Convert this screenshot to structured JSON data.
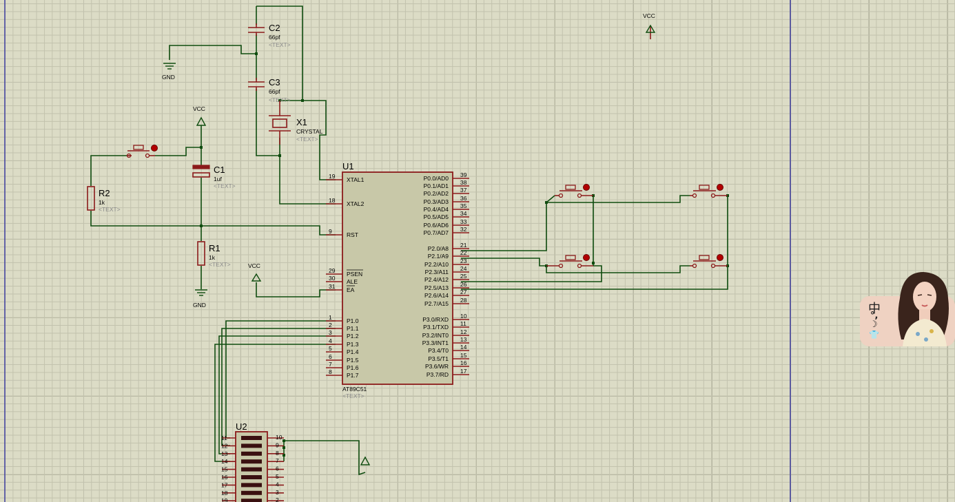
{
  "u1": {
    "ref": "U1",
    "part": "AT89C51",
    "text": "<TEXT>",
    "left_pins": [
      {
        "num": "19",
        "name": "XTAL1"
      },
      {
        "num": "18",
        "name": "XTAL2"
      },
      {
        "num": "9",
        "name": "RST"
      },
      {
        "num": "29",
        "name": "PSEN"
      },
      {
        "num": "30",
        "name": "ALE"
      },
      {
        "num": "31",
        "name": "EA"
      },
      {
        "num": "1",
        "name": "P1.0"
      },
      {
        "num": "2",
        "name": "P1.1"
      },
      {
        "num": "3",
        "name": "P1.2"
      },
      {
        "num": "4",
        "name": "P1.3"
      },
      {
        "num": "5",
        "name": "P1.4"
      },
      {
        "num": "6",
        "name": "P1.5"
      },
      {
        "num": "7",
        "name": "P1.6"
      },
      {
        "num": "8",
        "name": "P1.7"
      }
    ],
    "right_pins": [
      {
        "num": "39",
        "name": "P0.0/AD0"
      },
      {
        "num": "38",
        "name": "P0.1/AD1"
      },
      {
        "num": "37",
        "name": "P0.2/AD2"
      },
      {
        "num": "36",
        "name": "P0.3/AD3"
      },
      {
        "num": "35",
        "name": "P0.4/AD4"
      },
      {
        "num": "34",
        "name": "P0.5/AD5"
      },
      {
        "num": "33",
        "name": "P0.6/AD6"
      },
      {
        "num": "32",
        "name": "P0.7/AD7"
      },
      {
        "num": "21",
        "name": "P2.0/A8"
      },
      {
        "num": "22",
        "name": "P2.1/A9"
      },
      {
        "num": "23",
        "name": "P2.2/A10"
      },
      {
        "num": "24",
        "name": "P2.3/A11"
      },
      {
        "num": "25",
        "name": "P2.4/A12"
      },
      {
        "num": "26",
        "name": "P2.5/A13"
      },
      {
        "num": "27",
        "name": "P2.6/A14"
      },
      {
        "num": "28",
        "name": "P2.7/A15"
      },
      {
        "num": "10",
        "name": "P3.0/RXD"
      },
      {
        "num": "11",
        "name": "P3.1/TXD"
      },
      {
        "num": "12",
        "name": "P3.2/INT0"
      },
      {
        "num": "13",
        "name": "P3.3/INT1"
      },
      {
        "num": "14",
        "name": "P3.4/T0"
      },
      {
        "num": "15",
        "name": "P3.5/T1"
      },
      {
        "num": "16",
        "name": "P3.6/WR"
      },
      {
        "num": "17",
        "name": "P3.7/RD"
      }
    ]
  },
  "c2": {
    "ref": "C2",
    "value": "66pf",
    "text": "<TEXT>"
  },
  "c3": {
    "ref": "C3",
    "value": "66pf",
    "text": "<TEXT>"
  },
  "x1": {
    "ref": "X1",
    "value": "CRYSTAL",
    "text": "<TEXT>"
  },
  "c1": {
    "ref": "C1",
    "value": "1uf",
    "text": "<TEXT>"
  },
  "r1": {
    "ref": "R1",
    "value": "1k",
    "text": "<TEXT>"
  },
  "r2": {
    "ref": "R2",
    "value": "1k",
    "text": "<TEXT>"
  },
  "u2": {
    "ref": "U2",
    "left_pins": [
      "11",
      "12",
      "13",
      "14",
      "15",
      "16",
      "17",
      "18",
      "19"
    ],
    "right_pins": [
      "10",
      "9",
      "8",
      "7",
      "6",
      "5",
      "4",
      "3",
      "2"
    ]
  },
  "power": {
    "vcc": "VCC",
    "gnd": "GND"
  },
  "avatar_glyphs": [
    "中",
    "°,",
    "☽",
    "👕"
  ],
  "colors": {
    "wire": "#0f4c0f",
    "component": "#8b1a1a",
    "chip_body": "#c8c8a8",
    "grid": "#dcdcc6"
  }
}
